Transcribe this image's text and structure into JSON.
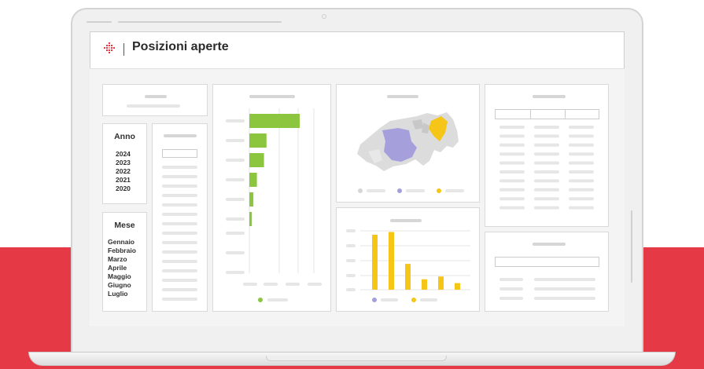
{
  "app": {
    "title": "Posizioni aperte"
  },
  "filters": {
    "anno": {
      "title": "Anno",
      "options": [
        "2024",
        "2023",
        "2022",
        "2021",
        "2020"
      ]
    },
    "mese": {
      "title": "Mese",
      "options": [
        "Gennaio",
        "Febbraio",
        "Marzo",
        "Aprile",
        "Maggio",
        "Giugno",
        "Luglio"
      ]
    }
  },
  "colors": {
    "accent_red": "#e63946",
    "bar_green": "#8cc63f",
    "bar_yellow": "#f5c518",
    "map_purple": "#a59fdc",
    "map_yellow": "#f5c518",
    "placeholder": "#e6e6e6"
  },
  "icons": {
    "logo": "swiss-cross-diamond-logo"
  },
  "chart_data": [
    {
      "type": "bar",
      "orientation": "horizontal",
      "values": [
        10,
        3.4,
        2.9,
        1.5,
        0.8,
        0.5
      ],
      "xlim": [
        0,
        10
      ]
    },
    {
      "type": "bar",
      "orientation": "vertical",
      "values": [
        10,
        10.5,
        4.7,
        1.9,
        2.4,
        1.2
      ],
      "ylim": [
        0,
        12
      ]
    }
  ]
}
